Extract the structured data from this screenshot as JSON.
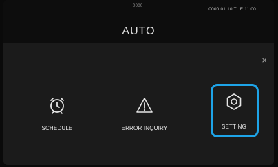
{
  "header": {
    "top_label": "0000",
    "datetime": "0000.01.10 TUE 11:00",
    "mode": "AUTO"
  },
  "menu": {
    "close_glyph": "×",
    "options": [
      {
        "label": "SCHEDULE",
        "icon": "alarm-clock-icon"
      },
      {
        "label": "ERROR INQUIRY",
        "icon": "warning-triangle-icon"
      },
      {
        "label": "SETTING",
        "icon": "gear-icon",
        "selected": true
      }
    ]
  },
  "colors": {
    "accent": "#1ea4e8",
    "background": "#1b1b1b",
    "header": "#0d0d0d"
  }
}
